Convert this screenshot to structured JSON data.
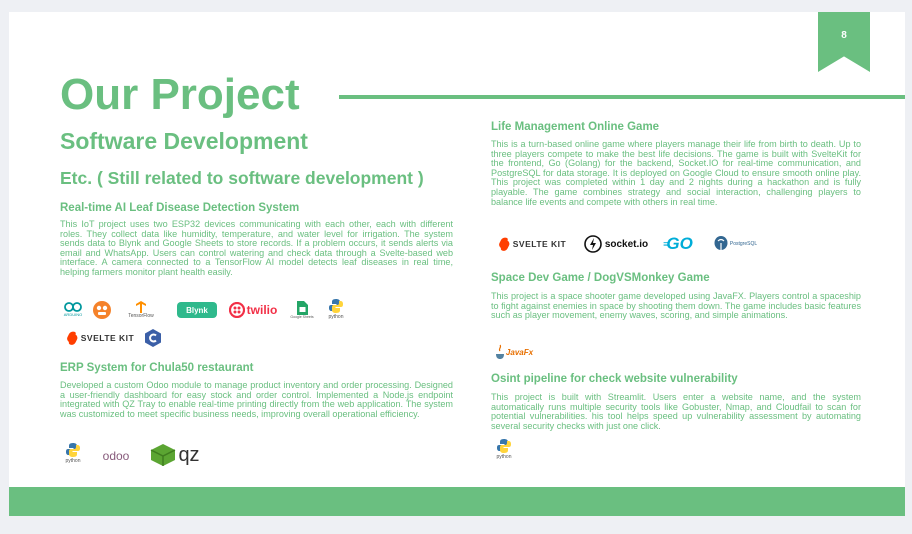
{
  "page_number": "8",
  "title": "Our Project",
  "subtitle": "Software Development",
  "sub_subtitle": "Etc. ( Still related to software development )",
  "projects": [
    {
      "title": "Real-time AI Leaf Disease Detection System",
      "description": "This IoT project uses two ESP32 devices communicating with each other, each with different roles. They collect data like humidity, temperature, and water level for irrigation. The system sends data to Blynk and Google Sheets to store records. If a problem occurs, it sends alerts via email and WhatsApp. Users can control watering and check data through a Svelte-based web interface. A camera connected to a TensorFlow AI model detects leaf diseases in real time, helping farmers monitor plant health easily.",
      "logos": {
        "arduino": "ARDUINO",
        "tensorflow": "TensorFlow",
        "blynk": "Blynk",
        "twilio": "twilio",
        "google_sheets": "Google Sheets",
        "python": "python",
        "sveltekit": "SVELTE KIT"
      }
    },
    {
      "title": "ERP System for Chula50 restaurant",
      "description": "Developed a custom Odoo module to manage product inventory and order processing. Designed a user-friendly dashboard for easy stock and order control. Implemented a Node.js endpoint integrated with QZ Tray to enable real-time printing directly from the web application. The system was customized to meet specific business needs, improving overall operational efficiency.",
      "logos": {
        "python": "python",
        "odoo": "odoo",
        "qz": "qz"
      }
    },
    {
      "title": "Life Management Online Game",
      "description": "This is a turn-based online game where players manage their life from birth to death. Up to three players compete to make the best life decisions. The game is built with SvelteKit for the frontend, Go (Golang) for the backend, Socket.IO for real-time communication, and PostgreSQL for data storage. It is deployed on Google Cloud to ensure smooth online play. This project was completed within 1 day and 2 nights during a hackathon and is fully playable. The game combines strategy and social interaction, challenging players to balance life events and compete with others in real time.",
      "logos": {
        "sveltekit": "SVELTE KIT",
        "socketio": "socket.io",
        "go": "GO",
        "postgresql": "PostgreSQL"
      }
    },
    {
      "title": "Space Dev Game / DogVSMonkey Game",
      "description": "This project is a space shooter game developed using JavaFX. Players control a spaceship to fight against enemies in space by shooting them down. The game includes basic features such as player movement, enemy waves, scoring, and simple animations.",
      "logos": {
        "javafx": "JavaFx"
      }
    },
    {
      "title": "Osint pipeline for check website vulnerability",
      "description": "This project is built with Streamlit. Users enter a website name, and the system automatically runs multiple security tools like Gobuster, Nmap, and Cloudfail to scan for potential vulnerabilities. his tool helps speed up vulnerability assessment by automating several security checks with just one click.",
      "logos": {
        "python": "python"
      }
    }
  ],
  "colors": {
    "accent": "#6abf80",
    "background": "#eef0f4"
  }
}
